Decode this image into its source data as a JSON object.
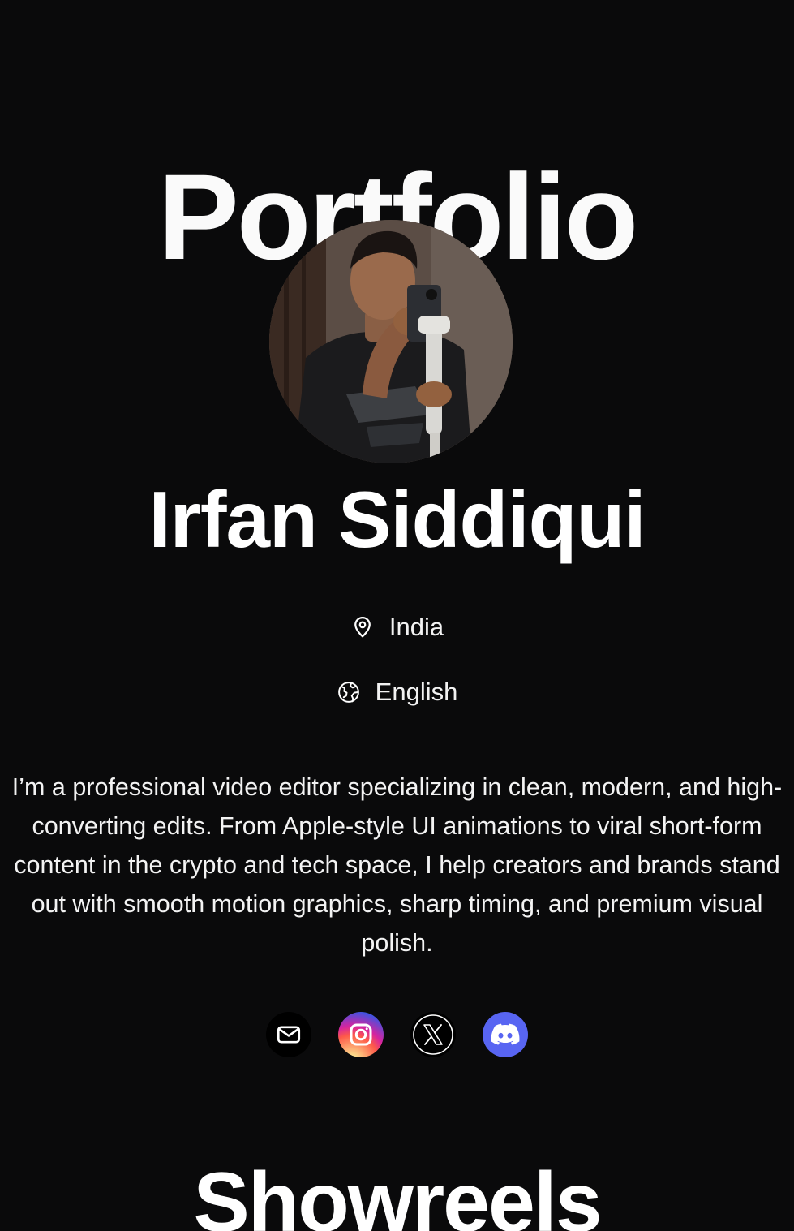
{
  "hero": {
    "title": "Portfolio"
  },
  "profile": {
    "name": "Irfan Siddiqui",
    "location": "India",
    "language": "English",
    "bio": "I’m a professional video editor specializing in clean, modern, and high-converting edits. From Apple-style UI animations to viral short-form content in the crypto and tech space, I help creators and brands stand out with smooth motion graphics, sharp timing, and premium visual polish."
  },
  "socials": [
    {
      "name": "mail",
      "icon": "mail-icon",
      "color": "#000000"
    },
    {
      "name": "instagram",
      "icon": "instagram-icon",
      "color": "#d6249f"
    },
    {
      "name": "x",
      "icon": "x-icon",
      "color": "#000000"
    },
    {
      "name": "discord",
      "icon": "discord-icon",
      "color": "#5865f2"
    }
  ],
  "showreels": {
    "title": "Showreels"
  },
  "colors": {
    "background": "#0a0a0b",
    "text": "#ffffff",
    "discord": "#5865f2"
  }
}
